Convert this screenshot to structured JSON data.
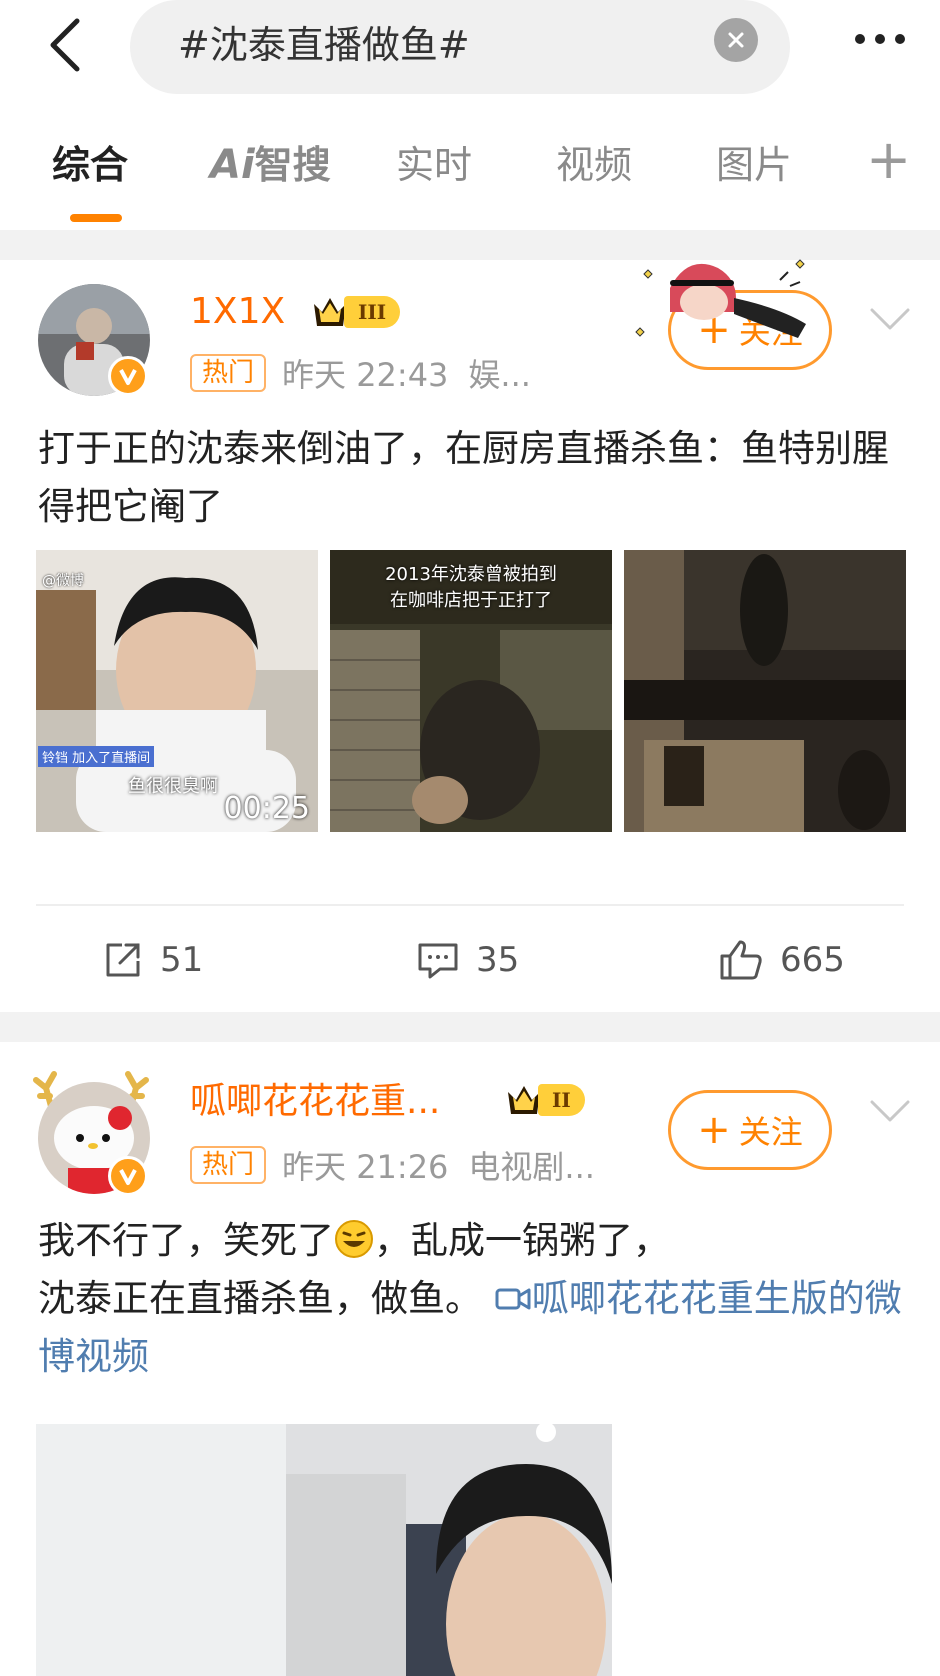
{
  "search": {
    "query": "#沈泰直播做鱼#"
  },
  "tabs": [
    {
      "label": "综合",
      "active": true
    },
    {
      "label_ai": "Ai",
      "label_rest": "智搜"
    },
    {
      "label": "实时"
    },
    {
      "label": "视频"
    },
    {
      "label": "图片"
    }
  ],
  "tab_plus": "+",
  "colors": {
    "accent": "#ff8200",
    "username": "#ff6a00",
    "link": "#507daf"
  },
  "posts": [
    {
      "username": "1X1X",
      "level": "III",
      "hot_tag": "热门",
      "time": "昨天 22:43",
      "source": "娱...",
      "follow_label": "关注",
      "text": "打于正的沈泰来倒油了，在厨房直播杀鱼：鱼特别腥得把它阉了",
      "images": [
        {
          "video_duration": "00:25",
          "caption": "鱼很很臭啊",
          "live_tag": "铃铛 加入了直播间",
          "watermark": "@微博"
        },
        {
          "overlay_line1": "2013年沈泰曾被拍到",
          "overlay_line2": "在咖啡店把于正打了"
        },
        {}
      ],
      "reposts": "51",
      "comments": "35",
      "likes": "665"
    },
    {
      "username": "呱唧花花花重...",
      "level": "II",
      "hot_tag": "热门",
      "time": "昨天 21:26",
      "source": "电视剧...",
      "follow_label": "关注",
      "text_part1": "我不行了，笑死了",
      "text_part2": "，乱成一锅粥了，",
      "text_part3": "沈泰正在直播杀鱼，做鱼。",
      "video_link": "呱唧花花花重生版的微博视频"
    }
  ]
}
